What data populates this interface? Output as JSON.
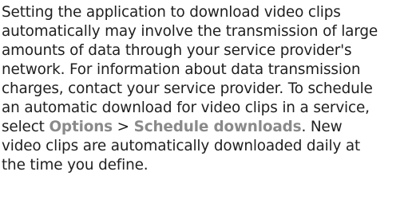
{
  "document": {
    "lines": [
      "Setting the application to download video clips",
      "automatically may involve the transmission of large",
      "amounts of data through your service provider's",
      "network. For information about data transmission",
      "charges, contact your service provider. To schedule",
      "an automatic download for video clips in a service,"
    ],
    "line7": {
      "prefix": "select ",
      "menu_options": "Options",
      "separator": " > ",
      "menu_schedule": "Schedule downloads",
      "suffix": ". New"
    },
    "line8": "video clips are automatically downloaded daily at",
    "line9": "the time you define."
  }
}
